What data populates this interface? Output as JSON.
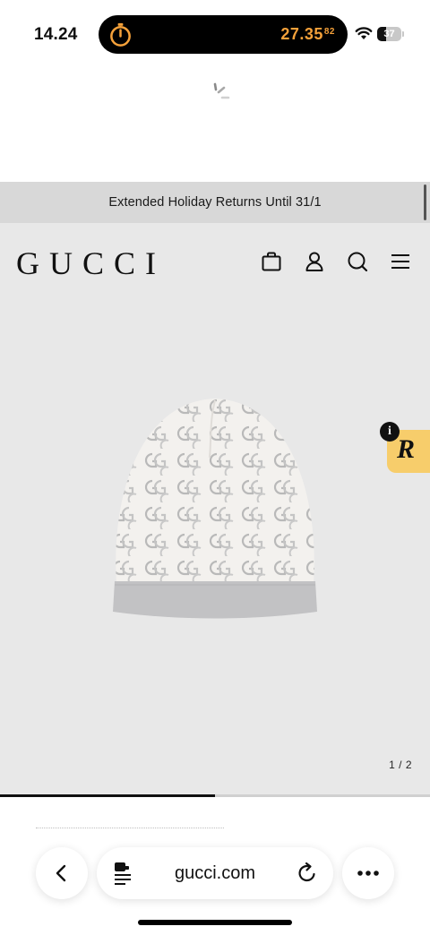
{
  "status_bar": {
    "time": "14.24",
    "timer_main": "27.35",
    "timer_fraction": "82",
    "battery_level": "37",
    "timer_color": "#f5a13a"
  },
  "announcement": {
    "text": "Extended Holiday Returns Until 31/1"
  },
  "header": {
    "logo": "GUCCI",
    "icons": [
      "shopping-bag-icon",
      "account-icon",
      "search-icon",
      "menu-icon"
    ]
  },
  "product_gallery": {
    "image": "gg-wool-beanie-hat",
    "pager": "1 / 2",
    "progress": 0.5
  },
  "widget": {
    "letter": "R",
    "info": "i",
    "color": "#f7cd6b"
  },
  "browser": {
    "url": "gucci.com",
    "icons": [
      "back-icon",
      "reader-icon",
      "reload-icon",
      "more-icon"
    ]
  }
}
